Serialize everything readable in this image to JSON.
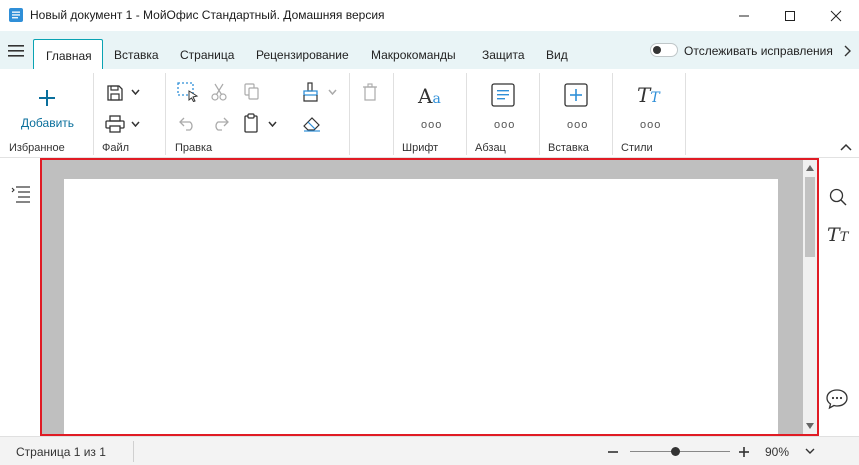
{
  "window": {
    "title": "Новый документ 1 - МойОфис Стандартный. Домашняя версия"
  },
  "tabs": {
    "items": [
      "Главная",
      "Вставка",
      "Страница",
      "Рецензирование",
      "Макрокоманды",
      "Защита",
      "Вид"
    ],
    "active": "Главная",
    "track_changes_label": "Отслеживать исправления"
  },
  "ribbon": {
    "favorites": {
      "add_label": "Добавить",
      "group_label": "Избранное"
    },
    "file": {
      "group_label": "Файл"
    },
    "edit": {
      "group_label": "Правка"
    },
    "font": {
      "group_label": "Шрифт",
      "more": "ооо"
    },
    "paragraph": {
      "group_label": "Абзац",
      "more": "ооо"
    },
    "insert": {
      "group_label": "Вставка",
      "more": "ооо"
    },
    "styles": {
      "group_label": "Стили",
      "more": "ооо"
    }
  },
  "status": {
    "page_info": "Страница 1 из 1",
    "zoom_value": "90%",
    "zoom_fraction": 0.45
  },
  "colors": {
    "accent": "#0aa3b3",
    "tab_bar_bg": "#e9f4f6",
    "highlight_border": "#e01b24",
    "doc_bg": "#bfbfbf"
  }
}
